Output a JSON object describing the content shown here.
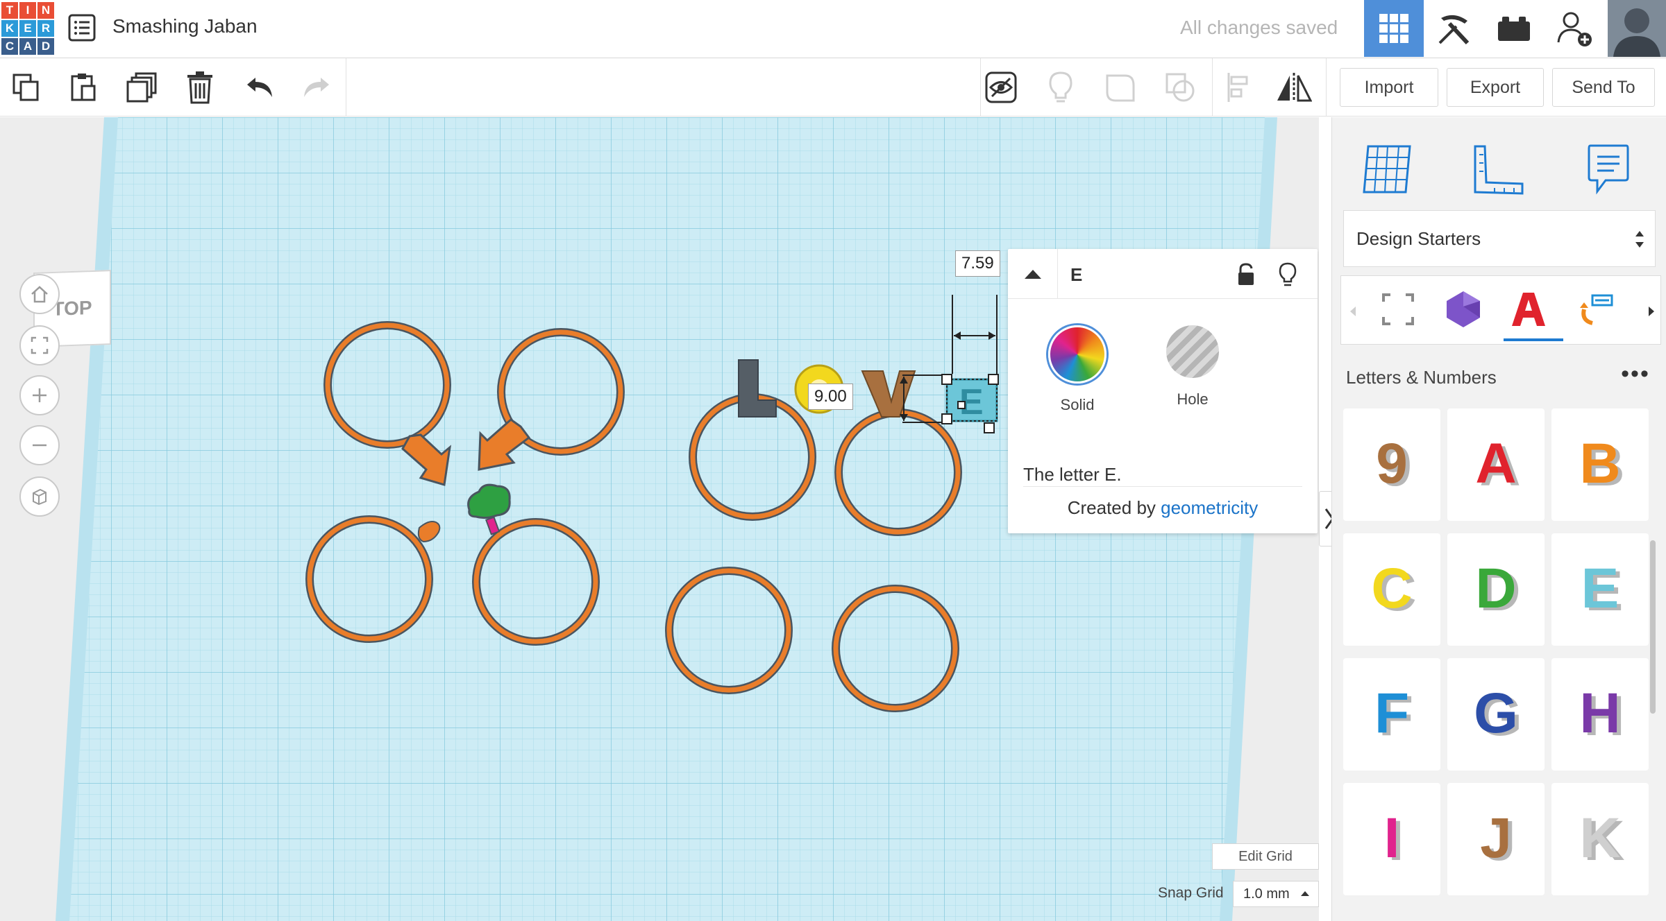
{
  "app": {
    "logo_letters": [
      "T",
      "I",
      "N",
      "K",
      "E",
      "R",
      "C",
      "A",
      "D"
    ],
    "logo_colors": [
      "#e94e35",
      "#e94e35",
      "#e94e35",
      "#2b9ad8",
      "#2b9ad8",
      "#2b9ad8",
      "#3a5e8c",
      "#3a5e8c",
      "#3a5e8c"
    ],
    "design_title": "Smashing Jaban",
    "save_status": "All changes saved",
    "accent_color": "#4f8fd9"
  },
  "topbar": {
    "icons": [
      "grid-view-icon",
      "pickaxe-icon",
      "bricks-icon",
      "add-user-icon",
      "user-avatar"
    ]
  },
  "toolbar": {
    "left_icons": [
      "copy-icon",
      "paste-icon",
      "duplicate-icon",
      "trash-icon",
      "undo-icon",
      "redo-icon"
    ],
    "right_icons": [
      "show-hide-icon",
      "lightbulb-icon",
      "group-icon",
      "ungroup-icon",
      "align-icon",
      "mirror-icon"
    ],
    "import_label": "Import",
    "export_label": "Export",
    "send_to_label": "Send To"
  },
  "viewcube": {
    "label": "TOP"
  },
  "inspector": {
    "shape_name": "E",
    "solid_label": "Solid",
    "hole_label": "Hole",
    "description": "The letter E.",
    "credit_prefix": "Created by ",
    "author": "geometricity"
  },
  "dimensions": {
    "width_label": "7.59",
    "height_label": "9.00"
  },
  "workplane": {
    "edit_grid_label": "Edit Grid",
    "snap_grid_label": "Snap Grid",
    "snap_value": "1.0 mm",
    "grid_color": "#a9dbe9",
    "plane_color": "#cdecf5",
    "ring_color": "#e97d2a"
  },
  "right_panel": {
    "tabs": [
      "workplane-icon",
      "ruler-icon",
      "notes-icon"
    ],
    "starter_value": "Design Starters",
    "categories": [
      "selection-box-icon",
      "polyhedron-icon",
      "letter-a-icon",
      "transform-icon"
    ],
    "section_title": "Letters & Numbers",
    "more_label": "•••",
    "shapes": [
      {
        "glyph": "9",
        "color": "#a8703f"
      },
      {
        "glyph": "A",
        "color": "#e0232d"
      },
      {
        "glyph": "B",
        "color": "#f08a1c"
      },
      {
        "glyph": "C",
        "color": "#f2d81e"
      },
      {
        "glyph": "D",
        "color": "#3aa83a"
      },
      {
        "glyph": "E",
        "color": "#6cc6d8"
      },
      {
        "glyph": "F",
        "color": "#1e8fd6"
      },
      {
        "glyph": "G",
        "color": "#2c4ea8"
      },
      {
        "glyph": "H",
        "color": "#7a3aa8"
      },
      {
        "glyph": "I",
        "color": "#e0238d"
      },
      {
        "glyph": "J",
        "color": "#a8703f"
      },
      {
        "glyph": "K",
        "color": "#cfcfcf"
      }
    ]
  }
}
